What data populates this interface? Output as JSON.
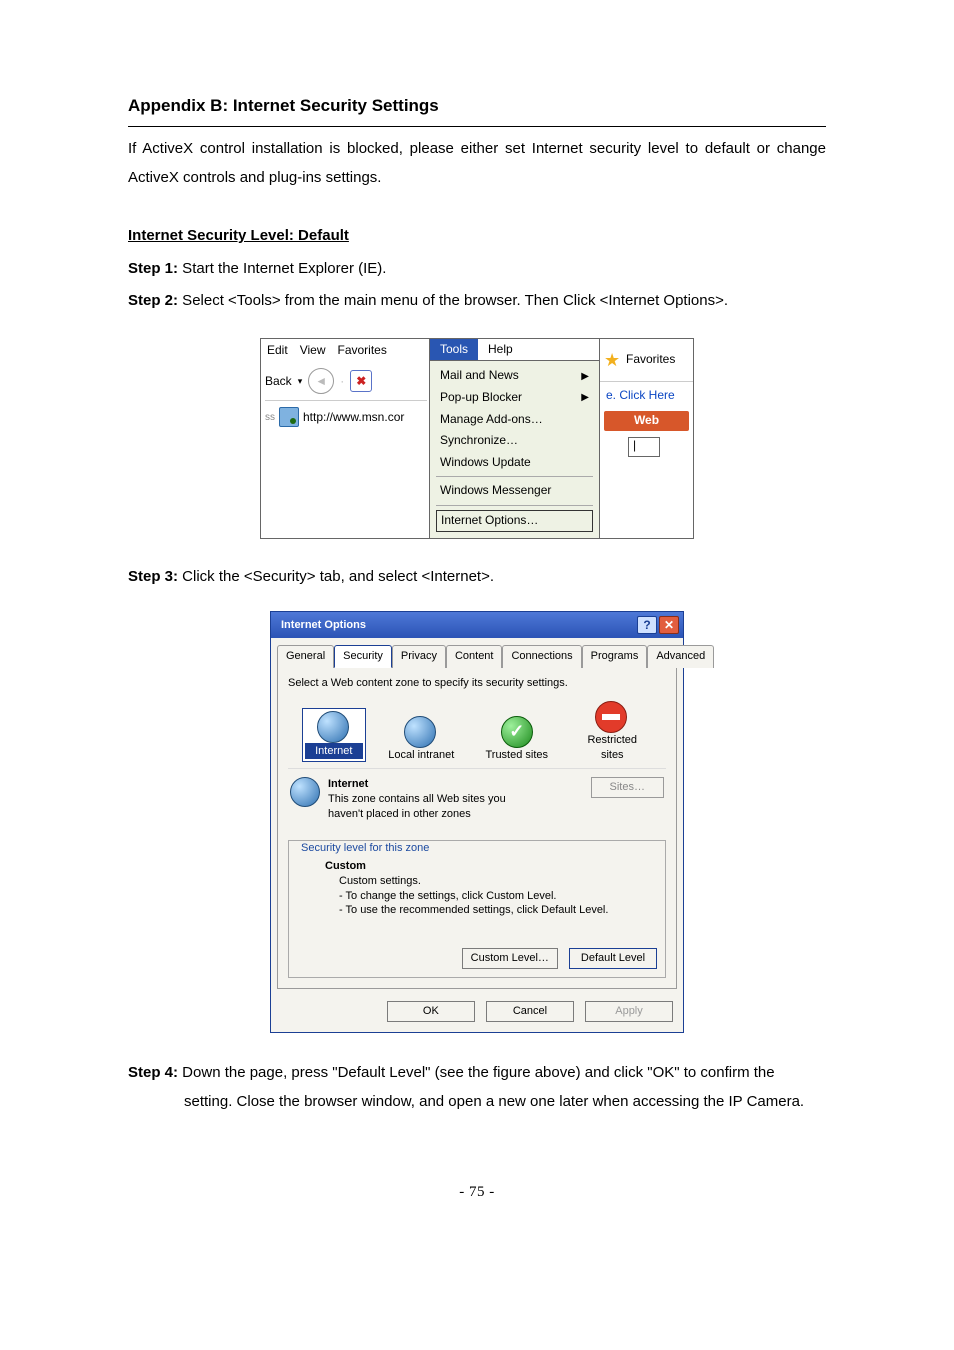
{
  "title": "Appendix B: Internet Security Settings",
  "intro": "If ActiveX control installation is blocked, please either set Internet security level to default or change ActiveX controls and plug-ins settings.",
  "section": "Internet Security Level: Default",
  "step1": {
    "label": "Step 1:",
    "text": " Start the Internet Explorer (IE)."
  },
  "step2": {
    "label": "Step 2:",
    "text": " Select <Tools> from the main menu of the browser. Then Click <Internet Options>."
  },
  "fig1": {
    "menus": {
      "edit": "Edit",
      "view": "View",
      "favorites_m": "Favorites"
    },
    "back": "Back",
    "address": "http://www.msn.cor",
    "tools": "Tools",
    "help": "Help",
    "dd": {
      "mail": "Mail and News",
      "popup": "Pop-up Blocker",
      "addons": "Manage Add-ons…",
      "sync": "Synchronize…",
      "update": "Windows Update",
      "messenger": "Windows Messenger",
      "internet_options": "Internet Options…"
    },
    "favorites": "Favorites",
    "click_here": "e. Click Here",
    "web": "Web"
  },
  "step3": {
    "label": "Step 3:",
    "text": " Click the <Security> tab, and select <Internet>."
  },
  "fig2": {
    "titlebar": "Internet Options",
    "tabs": {
      "general": "General",
      "security": "Security",
      "privacy": "Privacy",
      "content": "Content",
      "connections": "Connections",
      "programs": "Programs",
      "advanced": "Advanced"
    },
    "select_line": "Select a Web content zone to specify its security settings.",
    "zones": {
      "internet": "Internet",
      "local": "Local intranet",
      "trusted": "Trusted sites",
      "restricted1": "Restricted",
      "restricted2": "sites"
    },
    "zone_desc": {
      "head": "Internet",
      "line1": "This zone contains all Web sites you",
      "line2": "haven't placed in other zones"
    },
    "sites_btn": "Sites…",
    "sec_legend": "Security level for this zone",
    "custom": {
      "head": "Custom",
      "l1": "Custom settings.",
      "l2": "- To change the settings, click Custom Level.",
      "l3": "- To use the recommended settings, click Default Level."
    },
    "buttons": {
      "custom_level": "Custom Level…",
      "default_level": "Default Level",
      "ok": "OK",
      "cancel": "Cancel",
      "apply": "Apply"
    }
  },
  "step4": {
    "label": "Step 4:",
    "text_first": " Down the page, press \"Default Level\" (see the figure above) and click \"OK\" to confirm the ",
    "text_cont": "setting. Close the browser window, and open a new one later when accessing the IP Camera."
  },
  "page_number": "- 75 -"
}
